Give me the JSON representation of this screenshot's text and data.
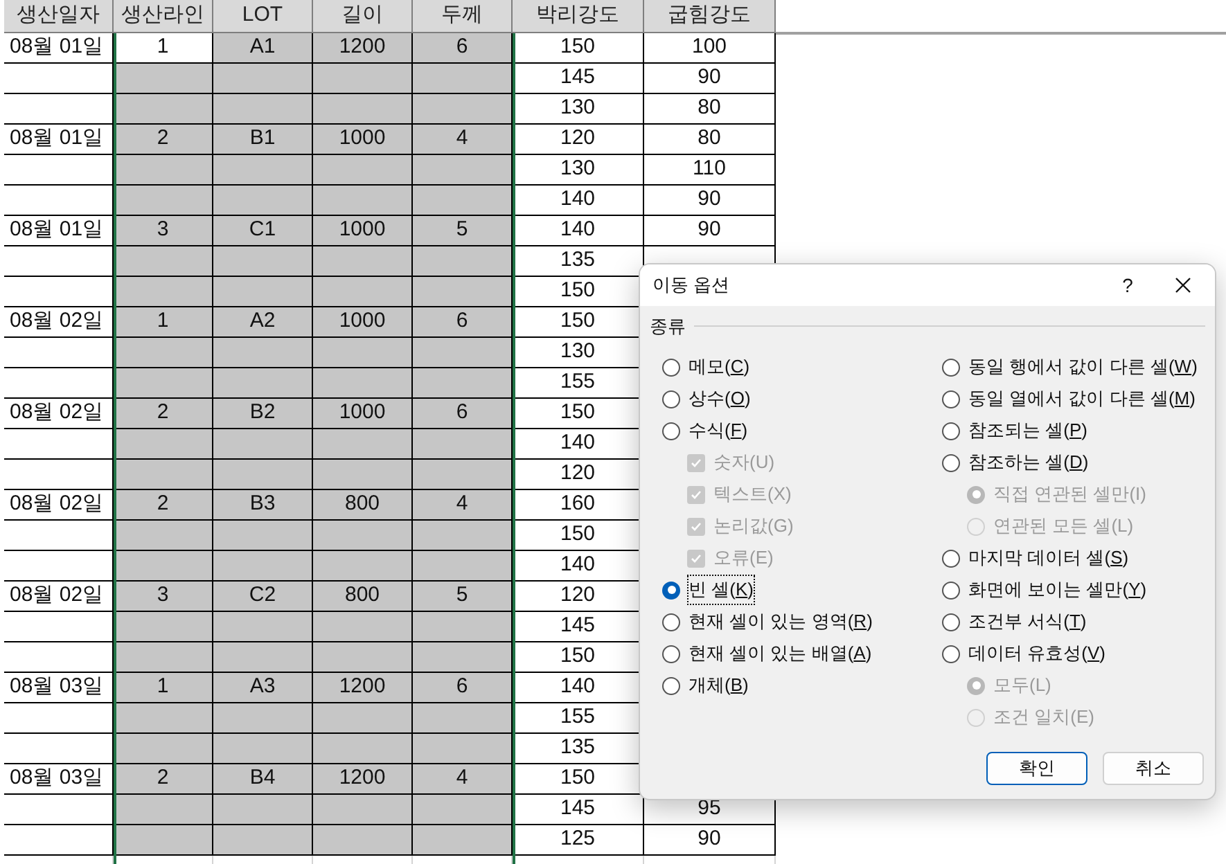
{
  "sheet": {
    "columns": [
      "생산일자",
      "생산라인",
      "LOT",
      "길이",
      "두께",
      "박리강도",
      "굽힘강도"
    ],
    "rows": [
      {
        "cells": [
          "08월 01일",
          "1",
          "A1",
          "1200",
          "6",
          "150",
          "100"
        ],
        "selected": [
          false,
          true,
          true,
          true
        ]
      },
      {
        "cells": [
          null,
          null,
          null,
          null,
          null,
          "145",
          "90"
        ],
        "selected": [
          true,
          true,
          true,
          true
        ]
      },
      {
        "cells": [
          null,
          null,
          null,
          null,
          null,
          "130",
          "80"
        ],
        "selected": [
          true,
          true,
          true,
          true
        ]
      },
      {
        "cells": [
          "08월 01일",
          "2",
          "B1",
          "1000",
          "4",
          "120",
          "80"
        ],
        "selected": [
          true,
          true,
          true,
          true
        ]
      },
      {
        "cells": [
          null,
          null,
          null,
          null,
          null,
          "130",
          "110"
        ],
        "selected": [
          true,
          true,
          true,
          true
        ]
      },
      {
        "cells": [
          null,
          null,
          null,
          null,
          null,
          "140",
          "90"
        ],
        "selected": [
          true,
          true,
          true,
          true
        ]
      },
      {
        "cells": [
          "08월 01일",
          "3",
          "C1",
          "1000",
          "5",
          "140",
          "90"
        ],
        "selected": [
          true,
          true,
          true,
          true
        ]
      },
      {
        "cells": [
          null,
          null,
          null,
          null,
          null,
          "135",
          null
        ],
        "selected": [
          true,
          true,
          true,
          true
        ]
      },
      {
        "cells": [
          null,
          null,
          null,
          null,
          null,
          "150",
          null
        ],
        "selected": [
          true,
          true,
          true,
          true
        ]
      },
      {
        "cells": [
          "08월 02일",
          "1",
          "A2",
          "1000",
          "6",
          "150",
          null
        ],
        "selected": [
          true,
          true,
          true,
          true
        ]
      },
      {
        "cells": [
          null,
          null,
          null,
          null,
          null,
          "130",
          null
        ],
        "selected": [
          true,
          true,
          true,
          true
        ]
      },
      {
        "cells": [
          null,
          null,
          null,
          null,
          null,
          "155",
          null
        ],
        "selected": [
          true,
          true,
          true,
          true
        ]
      },
      {
        "cells": [
          "08월 02일",
          "2",
          "B2",
          "1000",
          "6",
          "150",
          null
        ],
        "selected": [
          true,
          true,
          true,
          true
        ]
      },
      {
        "cells": [
          null,
          null,
          null,
          null,
          null,
          "140",
          null
        ],
        "selected": [
          true,
          true,
          true,
          true
        ]
      },
      {
        "cells": [
          null,
          null,
          null,
          null,
          null,
          "120",
          null
        ],
        "selected": [
          true,
          true,
          true,
          true
        ]
      },
      {
        "cells": [
          "08월 02일",
          "2",
          "B3",
          "800",
          "4",
          "160",
          null
        ],
        "selected": [
          true,
          true,
          true,
          true
        ]
      },
      {
        "cells": [
          null,
          null,
          null,
          null,
          null,
          "150",
          null
        ],
        "selected": [
          true,
          true,
          true,
          true
        ]
      },
      {
        "cells": [
          null,
          null,
          null,
          null,
          null,
          "140",
          null
        ],
        "selected": [
          true,
          true,
          true,
          true
        ]
      },
      {
        "cells": [
          "08월 02일",
          "3",
          "C2",
          "800",
          "5",
          "120",
          null
        ],
        "selected": [
          true,
          true,
          true,
          true
        ]
      },
      {
        "cells": [
          null,
          null,
          null,
          null,
          null,
          "145",
          null
        ],
        "selected": [
          true,
          true,
          true,
          true
        ]
      },
      {
        "cells": [
          null,
          null,
          null,
          null,
          null,
          "150",
          null
        ],
        "selected": [
          true,
          true,
          true,
          true
        ]
      },
      {
        "cells": [
          "08월 03일",
          "1",
          "A3",
          "1200",
          "6",
          "140",
          null
        ],
        "selected": [
          true,
          true,
          true,
          true
        ]
      },
      {
        "cells": [
          null,
          null,
          null,
          null,
          null,
          "155",
          null
        ],
        "selected": [
          true,
          true,
          true,
          true
        ]
      },
      {
        "cells": [
          null,
          null,
          null,
          null,
          null,
          "135",
          null
        ],
        "selected": [
          true,
          true,
          true,
          true
        ]
      },
      {
        "cells": [
          "08월 03일",
          "2",
          "B4",
          "1200",
          "4",
          "150",
          null
        ],
        "selected": [
          true,
          true,
          true,
          true
        ]
      },
      {
        "cells": [
          null,
          null,
          null,
          null,
          null,
          "145",
          "95"
        ],
        "selected": [
          true,
          true,
          true,
          true
        ]
      },
      {
        "cells": [
          null,
          null,
          null,
          null,
          null,
          "125",
          "90"
        ],
        "selected": [
          true,
          true,
          true,
          true
        ]
      }
    ]
  },
  "dialog": {
    "title": "이동 옵션",
    "help": "?",
    "group": "종류",
    "left": [
      {
        "label": "메모(C)",
        "kind": "radio",
        "selected": false,
        "disabled": false
      },
      {
        "label": "상수(O)",
        "kind": "radio",
        "selected": false,
        "disabled": false
      },
      {
        "label": "수식(F)",
        "kind": "radio",
        "selected": false,
        "disabled": false,
        "children": [
          {
            "label": "숫자(U)",
            "kind": "checkbox",
            "checked": true,
            "disabled": true
          },
          {
            "label": "텍스트(X)",
            "kind": "checkbox",
            "checked": true,
            "disabled": true
          },
          {
            "label": "논리값(G)",
            "kind": "checkbox",
            "checked": true,
            "disabled": true
          },
          {
            "label": "오류(E)",
            "kind": "checkbox",
            "checked": true,
            "disabled": true
          }
        ]
      },
      {
        "label": "빈 셀(K)",
        "kind": "radio",
        "selected": true,
        "disabled": false,
        "focused": true
      },
      {
        "label": "현재 셀이 있는 영역(R)",
        "kind": "radio",
        "selected": false,
        "disabled": false
      },
      {
        "label": "현재 셀이 있는 배열(A)",
        "kind": "radio",
        "selected": false,
        "disabled": false
      },
      {
        "label": "개체(B)",
        "kind": "radio",
        "selected": false,
        "disabled": false
      }
    ],
    "right": [
      {
        "label": "동일 행에서 값이 다른 셀(W)",
        "kind": "radio",
        "selected": false,
        "disabled": false
      },
      {
        "label": "동일 열에서 값이 다른 셀(M)",
        "kind": "radio",
        "selected": false,
        "disabled": false
      },
      {
        "label": "참조되는 셀(P)",
        "kind": "radio",
        "selected": false,
        "disabled": false
      },
      {
        "label": "참조하는 셀(D)",
        "kind": "radio",
        "selected": false,
        "disabled": false,
        "children": [
          {
            "label": "직접 연관된 셀만(I)",
            "kind": "radio",
            "selected": true,
            "disabled": true
          },
          {
            "label": "연관된 모든 셀(L)",
            "kind": "radio",
            "selected": false,
            "disabled": true
          }
        ]
      },
      {
        "label": "마지막 데이터 셀(S)",
        "kind": "radio",
        "selected": false,
        "disabled": false
      },
      {
        "label": "화면에 보이는 셀만(Y)",
        "kind": "radio",
        "selected": false,
        "disabled": false
      },
      {
        "label": "조건부 서식(T)",
        "kind": "radio",
        "selected": false,
        "disabled": false
      },
      {
        "label": "데이터 유효성(V)",
        "kind": "radio",
        "selected": false,
        "disabled": false,
        "children": [
          {
            "label": "모두(L)",
            "kind": "radio",
            "selected": true,
            "disabled": true
          },
          {
            "label": "조건 일치(E)",
            "kind": "radio",
            "selected": false,
            "disabled": true
          }
        ]
      }
    ],
    "buttons": [
      {
        "label": "확인",
        "default": true
      },
      {
        "label": "취소",
        "default": false
      }
    ]
  }
}
